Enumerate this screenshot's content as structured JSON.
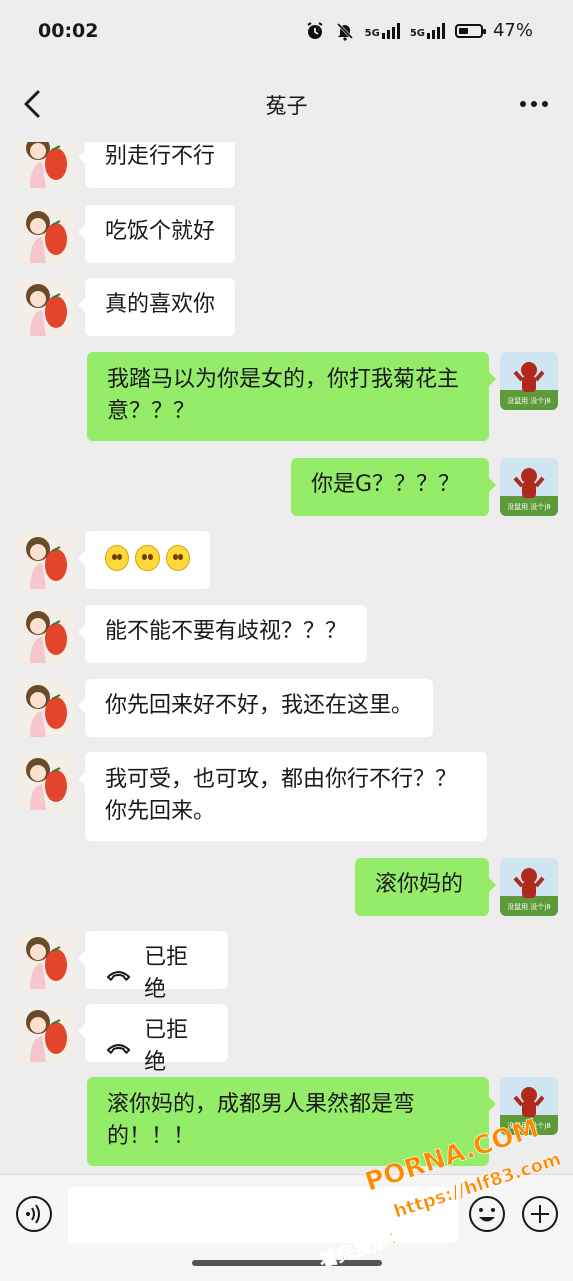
{
  "status_bar": {
    "time": "00:02",
    "signal1": "5G",
    "signal2": "5G",
    "battery_percent": "47%",
    "battery_level": 0.47
  },
  "header": {
    "title": "菟子"
  },
  "messages": [
    {
      "side": "in",
      "text": "别走行不行"
    },
    {
      "side": "in",
      "text": "吃饭个就好"
    },
    {
      "side": "in",
      "text": "真的喜欢你"
    },
    {
      "side": "out",
      "text": "我踏马以为你是女的，你打我菊花主意？？？"
    },
    {
      "side": "out",
      "text": "你是G？？？？"
    },
    {
      "side": "in",
      "type": "emoji",
      "emoji_count": 3
    },
    {
      "side": "in",
      "text": "能不能不要有歧视？？？"
    },
    {
      "side": "in",
      "text": "你先回来好不好，我还在这里。"
    },
    {
      "side": "in",
      "text": "我可受，也可攻，都由你行不行？？你先回来。"
    },
    {
      "side": "out",
      "text": "滚你妈的"
    },
    {
      "side": "in",
      "type": "call",
      "text": "已拒绝"
    },
    {
      "side": "in",
      "type": "call",
      "text": "已拒绝"
    },
    {
      "side": "out",
      "text": "滚你妈的，成都男人果然都是弯的！！！"
    }
  ],
  "avatars": {
    "right_caption": "没鼠用 没个j8"
  },
  "input_bar": {
    "placeholder": ""
  },
  "watermark": {
    "line1": "PORNA.COM",
    "line2": "https://hlf83.com",
    "line3": "看完整版："
  },
  "colors": {
    "background": "#ededed",
    "outgoing_bubble": "#95ec69",
    "incoming_bubble": "#ffffff",
    "watermark": "#ff8a00"
  }
}
